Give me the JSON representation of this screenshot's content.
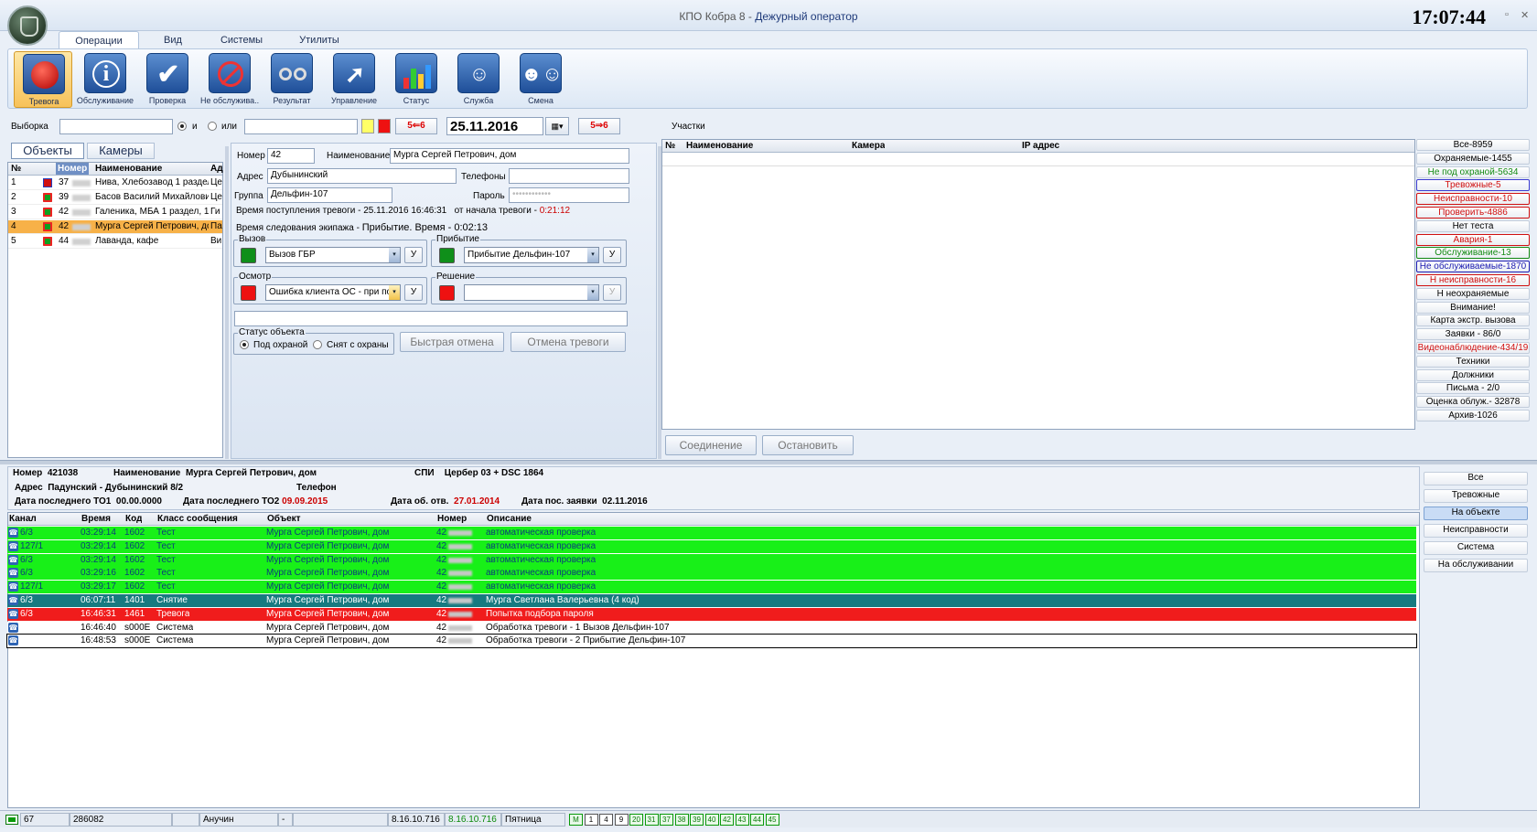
{
  "app": {
    "title": "КПО Кобра 8 - ",
    "role": "Дежурный оператор",
    "clock": "17:07:44",
    "win_min": "▫",
    "win_close": "✕"
  },
  "ribbon_tabs": [
    "Операции",
    "Вид",
    "Системы",
    "Утилиты"
  ],
  "ribbon_buttons": [
    {
      "label": "Тревога",
      "icon": "alarm-icon"
    },
    {
      "label": "Обслуживание",
      "icon": "info-icon"
    },
    {
      "label": "Проверка",
      "icon": "check-icon"
    },
    {
      "label": "Не обслужива...",
      "icon": "no-service-icon"
    },
    {
      "label": "Результат",
      "icon": "handcuffs-icon"
    },
    {
      "label": "Управление",
      "icon": "control-icon"
    },
    {
      "label": "Статус",
      "icon": "chart-icon"
    },
    {
      "label": "Служба",
      "icon": "service-icon"
    },
    {
      "label": "Смена",
      "icon": "shift-icon"
    }
  ],
  "filter": {
    "label": "Выборка",
    "and": "и",
    "or": "или",
    "btn56_a": "5⇐6",
    "btn56_b": "5⇒6",
    "date": "25.11.2016",
    "participants": "Участки"
  },
  "left_tabs": {
    "objects": "Объекты",
    "cameras": "Камеры"
  },
  "objects_grid": {
    "headers": [
      "№",
      "",
      "Номер",
      "Наименование",
      "Ад"
    ],
    "rows": [
      {
        "n": "1",
        "num": "37",
        "name": "Нива, Хлебозавод 1 раздел",
        "addr": "Це",
        "color": "#d01010",
        "square": true
      },
      {
        "n": "2",
        "num": "39",
        "name": "Басов Василий Михайлович",
        "addr": "Це",
        "color": "#1fa01f"
      },
      {
        "n": "3",
        "num": "42",
        "name": "Галеника, МБА 1 раздел, 1",
        "addr": "Ги",
        "color": "#1fa01f"
      },
      {
        "n": "4",
        "num": "42",
        "name": "Мурга Сергей Петрович, до",
        "addr": "Па",
        "color": "#1fa01f",
        "selected": true
      },
      {
        "n": "5",
        "num": "44",
        "name": "Лаванда, кафе",
        "addr": "Ви",
        "color": "#1fa01f"
      }
    ]
  },
  "detail": {
    "number_label": "Номер",
    "number_value": "42",
    "name_label": "Наименование",
    "name_value": "Мурга Сергей Петрович, дом",
    "address_label": "Адрес",
    "address_value": "Дубынинский",
    "phones_label": "Телефоны",
    "group_label": "Группа",
    "group_value": "Дельфин-107",
    "password_label": "Пароль",
    "alarm_time_label": "Время поступления тревоги - ",
    "alarm_time_value": "25.11.2016 16:46:31",
    "since_label": "от начала тревоги - ",
    "since_value": "0:21:12",
    "travel_label": "Время следования экипажа - ",
    "travel_value": "Прибытие. Время - 0:02:13",
    "call_group": "Вызов",
    "call_value": "Вызов ГБР",
    "arrival_group": "Прибытие",
    "arrival_value": "Прибытие Дельфин-107",
    "inspect_group": "Осмотр",
    "inspect_value": "Ошибка клиента ОС - при пос",
    "decision_group": "Решение",
    "decision_value": "",
    "u": "У",
    "status_group": "Статус объекта",
    "status_armed": "Под охраной",
    "status_disarmed": "Снят с охраны",
    "quick_cancel": "Быстрая отмена",
    "cancel_alarm": "Отмена тревоги"
  },
  "camera_grid": {
    "headers": [
      "№",
      "Наименование",
      "Камера",
      "IP адрес"
    ],
    "connect": "Соединение",
    "stop": "Остановить"
  },
  "right_filters": [
    {
      "label": "Все-8959",
      "color": "#000"
    },
    {
      "label": "Охраняемые-1455",
      "color": "#000"
    },
    {
      "label": "Не под охраной-5634",
      "color": "#138a13"
    },
    {
      "label": "Тревожные-5",
      "color": "#d01010",
      "border": "#3b3bd0"
    },
    {
      "label": "Неисправности-10",
      "color": "#d01010",
      "border": "#d01010"
    },
    {
      "label": "Проверить-4886",
      "color": "#d01010",
      "border": "#d01010"
    },
    {
      "label": "Нет теста",
      "color": "#000"
    },
    {
      "label": "Авария-1",
      "color": "#d01010",
      "border": "#d01010"
    },
    {
      "label": "Обслуживание-13",
      "color": "#138a13",
      "border": "#138a13"
    },
    {
      "label": "Не обслуживаемые-1870",
      "color": "#1a1ab0",
      "border": "#1a1ab0"
    },
    {
      "label": "Н неисправности-16",
      "color": "#d01010",
      "border": "#d01010"
    },
    {
      "label": "Н неохраняемые",
      "color": "#000"
    },
    {
      "label": "Внимание!",
      "color": "#000"
    },
    {
      "label": "Карта экстр. вызова",
      "color": "#000"
    },
    {
      "label": "Заявки - 86/0",
      "color": "#000"
    },
    {
      "label": "Видеонаблюдение-434/19",
      "color": "#d01010"
    },
    {
      "label": "Техники",
      "color": "#000"
    },
    {
      "label": "Должники",
      "color": "#000"
    },
    {
      "label": "Письма - 2/0",
      "color": "#000"
    },
    {
      "label": "Оценка облуж.- 32878",
      "color": "#000"
    },
    {
      "label": "Архив-1026",
      "color": "#000"
    }
  ],
  "info": {
    "number_label": "Номер",
    "number_value": "421038",
    "name_label": "Наименование",
    "name_value": "Мурга Сергей Петрович, дом",
    "spi_label": "СПИ",
    "spi_value": "Цербер 03 + DSC 1864",
    "address_label": "Адрес",
    "address_value": "Падунский - Дубынинский 8/2",
    "phone_label": "Телефон",
    "to1_label": "Дата последнего ТО1",
    "to1_value": "00.00.0000",
    "to2_label": "Дата последнего ТО2",
    "to2_value": "09.09.2015",
    "resp_label": "Дата об. отв.",
    "resp_value": "27.01.2014",
    "req_label": "Дата пос. заявки",
    "req_value": "02.11.2016"
  },
  "events": {
    "headers": [
      "Канал",
      "Время",
      "Код",
      "Класс сообщения",
      "Объект",
      "Номер",
      "Описание"
    ],
    "rows": [
      {
        "ch": "6/3",
        "time": "03:29:14",
        "code": "1602",
        "cls": "Тест",
        "obj": "Мурга Сергей Петрович, дом",
        "num": "42",
        "desc": "автоматическая проверка",
        "bg": "#18f018",
        "fg": "#0a3d7a"
      },
      {
        "ch": "127/1",
        "time": "03:29:14",
        "code": "1602",
        "cls": "Тест",
        "obj": "Мурга Сергей Петрович, дом",
        "num": "42",
        "desc": "автоматическая проверка",
        "bg": "#18f018",
        "fg": "#0a3d7a"
      },
      {
        "ch": "6/3",
        "time": "03:29:14",
        "code": "1602",
        "cls": "Тест",
        "obj": "Мурга Сергей Петрович, дом",
        "num": "42",
        "desc": "автоматическая проверка",
        "bg": "#18f018",
        "fg": "#0a3d7a"
      },
      {
        "ch": "6/3",
        "time": "03:29:16",
        "code": "1602",
        "cls": "Тест",
        "obj": "Мурга Сергей Петрович, дом",
        "num": "42",
        "desc": "автоматическая проверка",
        "bg": "#18f018",
        "fg": "#0a3d7a"
      },
      {
        "ch": "127/1",
        "time": "03:29:17",
        "code": "1602",
        "cls": "Тест",
        "obj": "Мурга Сергей Петрович, дом",
        "num": "42",
        "desc": "автоматическая проверка",
        "bg": "#18f018",
        "fg": "#0a3d7a"
      },
      {
        "ch": "6/3",
        "time": "06:07:11",
        "code": "1401",
        "cls": "Снятие",
        "obj": "Мурга Сергей Петрович, дом",
        "num": "42",
        "desc": "Мурга Светлана Валерьевна (4 код)",
        "bg": "#177a80",
        "fg": "#ffffff"
      },
      {
        "ch": "6/3",
        "time": "16:46:31",
        "code": "1461",
        "cls": "Тревога",
        "obj": "Мурга Сергей Петрович, дом",
        "num": "42",
        "desc": "Попытка подбора пароля",
        "bg": "#f01c1c",
        "fg": "#ffffff"
      },
      {
        "ch": "",
        "time": "16:46:40",
        "code": "s000E",
        "cls": "Система",
        "obj": "Мурга Сергей Петрович, дом",
        "num": "42",
        "desc": "Обработка тревоги - 1 Вызов Дельфин-107",
        "bg": "#ffffff",
        "fg": "#000000"
      },
      {
        "ch": "",
        "time": "16:48:53",
        "code": "s000E",
        "cls": "Система",
        "obj": "Мурга Сергей Петрович, дом",
        "num": "42",
        "desc": "Обработка тревоги - 2 Прибытие Дельфин-107",
        "bg": "#ffffff",
        "fg": "#000000",
        "boxed": true
      }
    ]
  },
  "event_filters": [
    "Все",
    "Тревожные",
    "На объекте",
    "Неисправности",
    "Система",
    "На обслуживании"
  ],
  "status": {
    "count": "67",
    "id": "286082",
    "user": "Анучин",
    "dash": "-",
    "ver1": "8.16.10.716",
    "ver2": "8.16.10.716",
    "day": "Пятница",
    "channels": [
      "M",
      "1",
      "4",
      "9",
      "20",
      "31",
      "37",
      "38",
      "39",
      "40",
      "42",
      "43",
      "44",
      "45"
    ]
  }
}
